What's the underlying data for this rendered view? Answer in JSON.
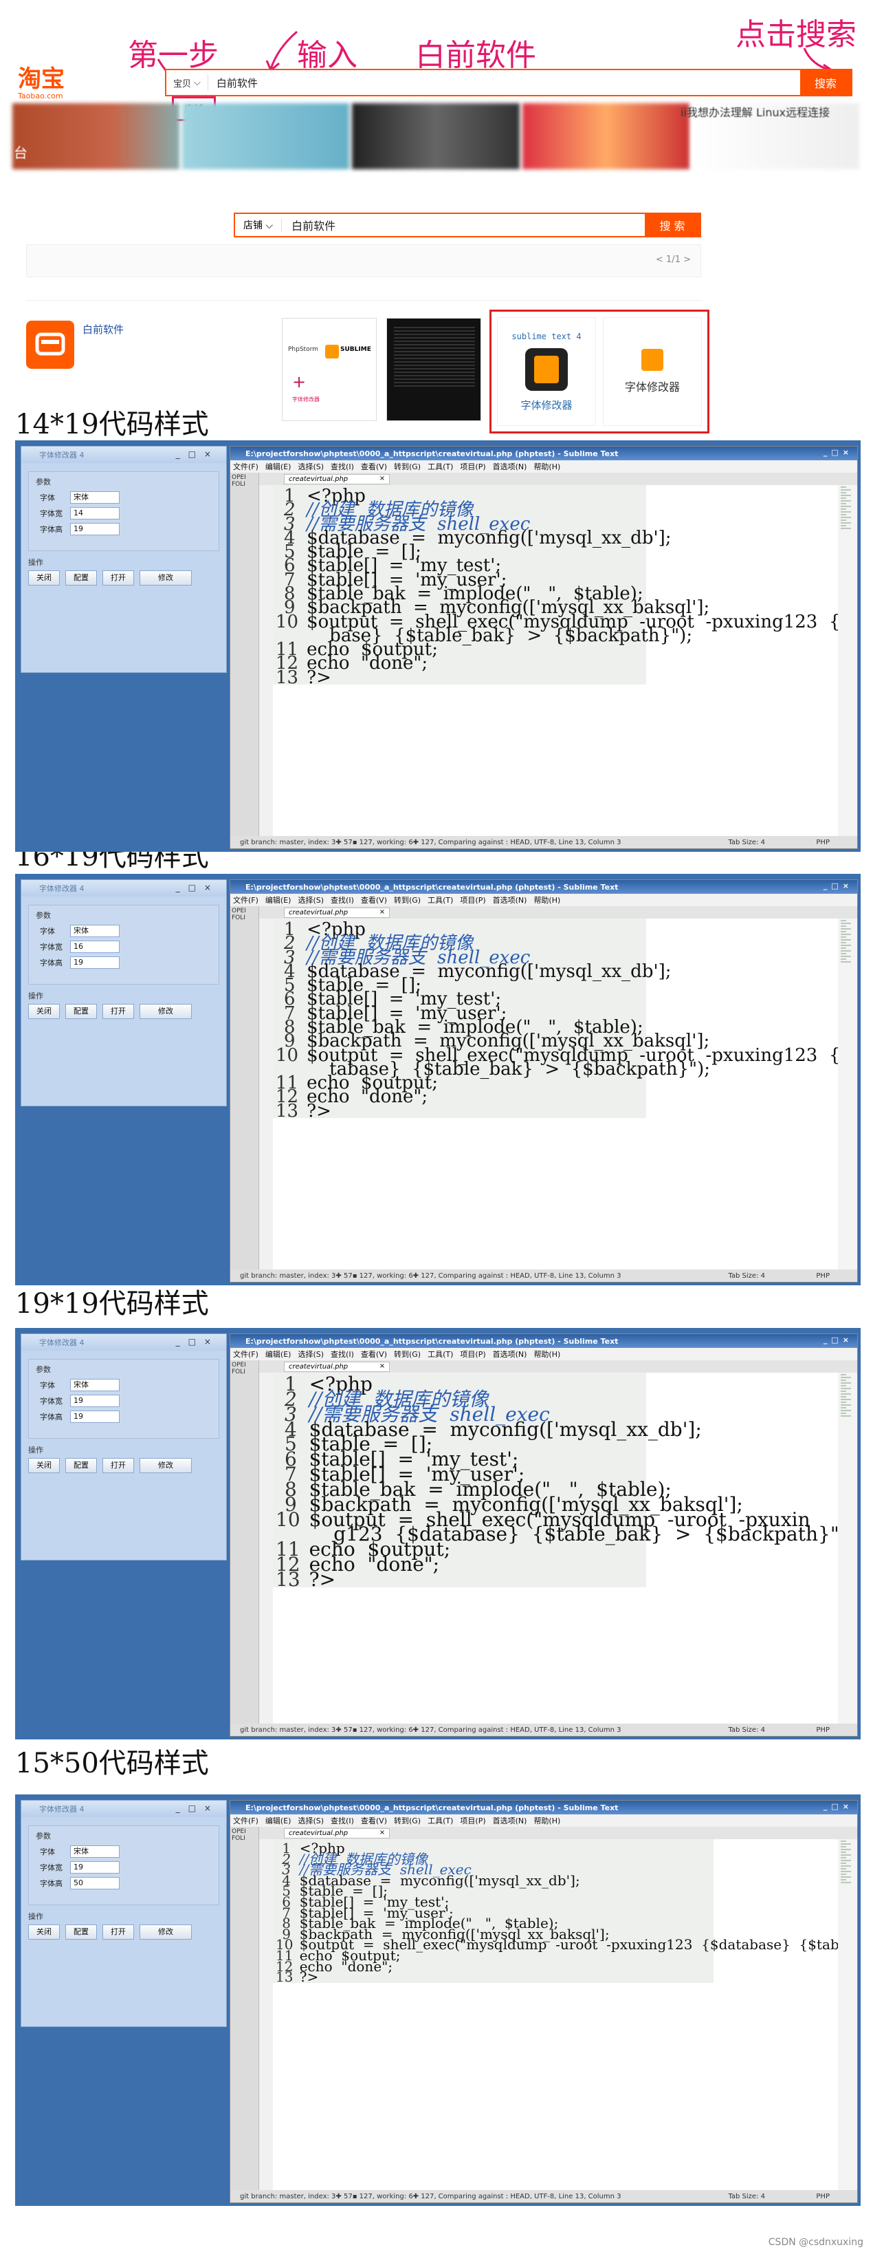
{
  "annotations": {
    "step1": "第一步",
    "input": "输入",
    "shop_name": "白前软件",
    "click_search": "点击搜索"
  },
  "taobao": {
    "logo": "淘宝",
    "logo_sub": "Taobao.com",
    "search_scope": "宝贝",
    "popup_option": "店铺",
    "search_value": "白前软件",
    "search_button": "搜索",
    "blur_text": "ii我想办法理解 Linux远程连接",
    "blur_badge": "台"
  },
  "shop_page": {
    "scope": "店铺",
    "value": "白前软件",
    "button": "搜 索",
    "pager": "< 1/1 >",
    "shop_name": "白前软件",
    "card1_title": "sublime text 4",
    "card1_label": "字体修改器",
    "card2_label": "字体修改器",
    "thumb_labels": [
      "PhpStorm",
      "SUBLIME",
      "字体修改器"
    ]
  },
  "sections": [
    {
      "title": "14*19代码样式",
      "font": "宋体",
      "width": "14",
      "height": "19"
    },
    {
      "title": "16*19代码样式",
      "font": "宋体",
      "width": "16",
      "height": "19"
    },
    {
      "title": "19*19代码样式",
      "font": "宋体",
      "width": "19",
      "height": "19"
    },
    {
      "title": "15*50代码样式",
      "font": "宋体",
      "width": "19",
      "height": "50"
    }
  ],
  "config": {
    "window_title": "字体修改器 4",
    "group_params": "参数",
    "label_font": "字体",
    "label_width": "字体宽",
    "label_height": "字体高",
    "group_ops": "操作",
    "btn_close": "关闭",
    "btn_config": "配置",
    "btn_open": "打开",
    "btn_modify": "修改"
  },
  "sublime": {
    "title": "E:\\projectforshow\\phptest\\0000_a_httpscript\\createvirtual.php (phptest) - Sublime Text",
    "menu": [
      "文件(F)",
      "编辑(E)",
      "选择(S)",
      "查找(I)",
      "查看(V)",
      "转到(G)",
      "工具(T)",
      "项目(P)",
      "首选项(N)",
      "帮助(H)"
    ],
    "sidebar_open": "OPEI",
    "sidebar_folders": "FOLI",
    "tab": "createvirtual.php",
    "status": "git branch: master, index: 3✚ 57▪ 127, working: 6✚ 127, Comparing against : HEAD, UTF-8, Line 13, Column 3",
    "tab_size": "Tab Size: 4",
    "syntax": "PHP"
  },
  "code": [
    [
      "<?php",
      ""
    ],
    [
      "//创建  数据库的镜像",
      "cm"
    ],
    [
      "//需要服务器支  shell_exec",
      "cm"
    ],
    [
      "$database  =  myconfig(['mysql_xx_db'];",
      ""
    ],
    [
      "$table  =  [];",
      ""
    ],
    [
      "$table[]  =  'my_test';",
      ""
    ],
    [
      "$table[]  =  'my_user';",
      ""
    ],
    [
      "$table_bak  =  implode(\"   \",  $table);",
      ""
    ],
    [
      "$backpath  =  myconfig(['mysql_xx_baksql'];",
      ""
    ],
    [
      "$output  =  shell_exec(\"mysqldump  -uroot  -pxuxing123  {$database}  {$table_bak}  >  {$backpath}\");",
      ""
    ],
    [
      "echo  $output;",
      ""
    ],
    [
      "echo  \"done\";",
      ""
    ],
    [
      "?>",
      ""
    ]
  ],
  "credit": "CSDN @csdnxuxing",
  "colors": {
    "taobao_orange": "#ff5000",
    "annotation_pink": "#e3196b",
    "highlight_red": "#e02020",
    "desktop_blue": "#3c6fac"
  }
}
